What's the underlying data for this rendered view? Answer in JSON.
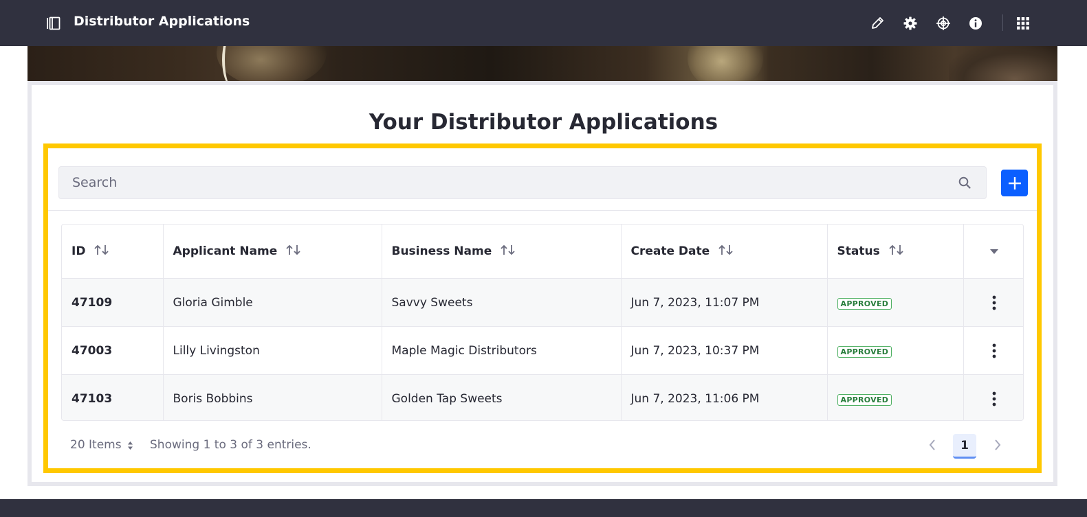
{
  "header": {
    "title": "Distributor Applications",
    "icons": [
      "sidebar-toggle-icon",
      "pencil-icon",
      "gear-icon",
      "target-icon",
      "info-icon",
      "apps-grid-icon"
    ]
  },
  "main": {
    "title": "Your Distributor Applications"
  },
  "search": {
    "placeholder": "Search",
    "value": ""
  },
  "table": {
    "columns": [
      "ID",
      "Applicant Name",
      "Business Name",
      "Create Date",
      "Status"
    ],
    "rows": [
      {
        "id": "47109",
        "applicant": "Gloria Gimble",
        "business": "Savvy Sweets",
        "date": "Jun 7, 2023, 11:07 PM",
        "status": "APPROVED"
      },
      {
        "id": "47003",
        "applicant": "Lilly Livingston",
        "business": "Maple Magic Distributors",
        "date": "Jun 7, 2023, 10:37 PM",
        "status": "APPROVED"
      },
      {
        "id": "47103",
        "applicant": "Boris Bobbins",
        "business": "Golden Tap Sweets",
        "date": "Jun 7, 2023, 11:06 PM",
        "status": "APPROVED"
      }
    ]
  },
  "footer": {
    "items_per_page": "20 Items",
    "showing": "Showing 1 to 3 of 3 entries.",
    "current_page": "1"
  },
  "colors": {
    "topbar": "#30313f",
    "accent": "#0b5fff",
    "highlight": "#ffc800",
    "approved": "#287d3c"
  }
}
